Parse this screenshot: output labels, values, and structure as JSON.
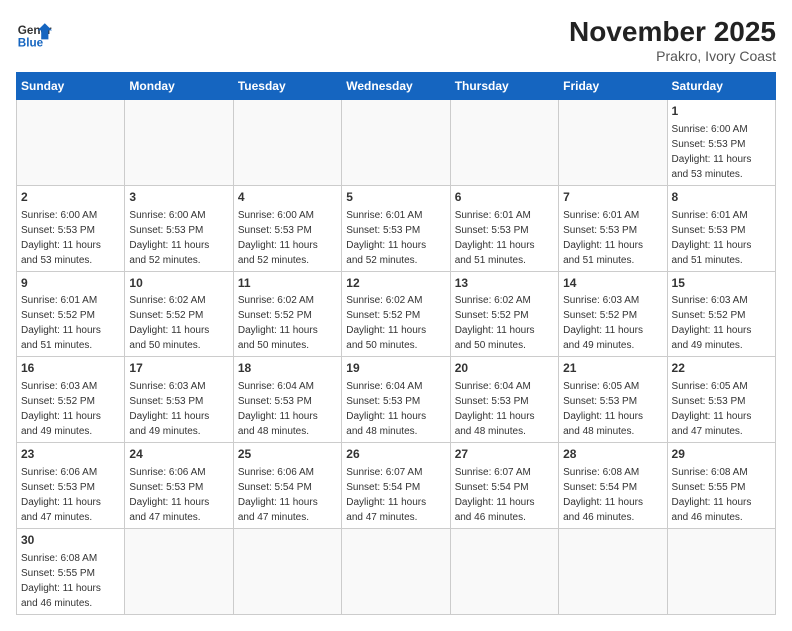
{
  "header": {
    "logo_general": "General",
    "logo_blue": "Blue",
    "month_title": "November 2025",
    "location": "Prakro, Ivory Coast"
  },
  "days_of_week": [
    "Sunday",
    "Monday",
    "Tuesday",
    "Wednesday",
    "Thursday",
    "Friday",
    "Saturday"
  ],
  "weeks": [
    [
      {
        "day": "",
        "info": ""
      },
      {
        "day": "",
        "info": ""
      },
      {
        "day": "",
        "info": ""
      },
      {
        "day": "",
        "info": ""
      },
      {
        "day": "",
        "info": ""
      },
      {
        "day": "",
        "info": ""
      },
      {
        "day": "1",
        "info": "Sunrise: 6:00 AM\nSunset: 5:53 PM\nDaylight: 11 hours\nand 53 minutes."
      }
    ],
    [
      {
        "day": "2",
        "info": "Sunrise: 6:00 AM\nSunset: 5:53 PM\nDaylight: 11 hours\nand 53 minutes."
      },
      {
        "day": "3",
        "info": "Sunrise: 6:00 AM\nSunset: 5:53 PM\nDaylight: 11 hours\nand 52 minutes."
      },
      {
        "day": "4",
        "info": "Sunrise: 6:00 AM\nSunset: 5:53 PM\nDaylight: 11 hours\nand 52 minutes."
      },
      {
        "day": "5",
        "info": "Sunrise: 6:01 AM\nSunset: 5:53 PM\nDaylight: 11 hours\nand 52 minutes."
      },
      {
        "day": "6",
        "info": "Sunrise: 6:01 AM\nSunset: 5:53 PM\nDaylight: 11 hours\nand 51 minutes."
      },
      {
        "day": "7",
        "info": "Sunrise: 6:01 AM\nSunset: 5:53 PM\nDaylight: 11 hours\nand 51 minutes."
      },
      {
        "day": "8",
        "info": "Sunrise: 6:01 AM\nSunset: 5:53 PM\nDaylight: 11 hours\nand 51 minutes."
      }
    ],
    [
      {
        "day": "9",
        "info": "Sunrise: 6:01 AM\nSunset: 5:52 PM\nDaylight: 11 hours\nand 51 minutes."
      },
      {
        "day": "10",
        "info": "Sunrise: 6:02 AM\nSunset: 5:52 PM\nDaylight: 11 hours\nand 50 minutes."
      },
      {
        "day": "11",
        "info": "Sunrise: 6:02 AM\nSunset: 5:52 PM\nDaylight: 11 hours\nand 50 minutes."
      },
      {
        "day": "12",
        "info": "Sunrise: 6:02 AM\nSunset: 5:52 PM\nDaylight: 11 hours\nand 50 minutes."
      },
      {
        "day": "13",
        "info": "Sunrise: 6:02 AM\nSunset: 5:52 PM\nDaylight: 11 hours\nand 50 minutes."
      },
      {
        "day": "14",
        "info": "Sunrise: 6:03 AM\nSunset: 5:52 PM\nDaylight: 11 hours\nand 49 minutes."
      },
      {
        "day": "15",
        "info": "Sunrise: 6:03 AM\nSunset: 5:52 PM\nDaylight: 11 hours\nand 49 minutes."
      }
    ],
    [
      {
        "day": "16",
        "info": "Sunrise: 6:03 AM\nSunset: 5:52 PM\nDaylight: 11 hours\nand 49 minutes."
      },
      {
        "day": "17",
        "info": "Sunrise: 6:03 AM\nSunset: 5:53 PM\nDaylight: 11 hours\nand 49 minutes."
      },
      {
        "day": "18",
        "info": "Sunrise: 6:04 AM\nSunset: 5:53 PM\nDaylight: 11 hours\nand 48 minutes."
      },
      {
        "day": "19",
        "info": "Sunrise: 6:04 AM\nSunset: 5:53 PM\nDaylight: 11 hours\nand 48 minutes."
      },
      {
        "day": "20",
        "info": "Sunrise: 6:04 AM\nSunset: 5:53 PM\nDaylight: 11 hours\nand 48 minutes."
      },
      {
        "day": "21",
        "info": "Sunrise: 6:05 AM\nSunset: 5:53 PM\nDaylight: 11 hours\nand 48 minutes."
      },
      {
        "day": "22",
        "info": "Sunrise: 6:05 AM\nSunset: 5:53 PM\nDaylight: 11 hours\nand 47 minutes."
      }
    ],
    [
      {
        "day": "23",
        "info": "Sunrise: 6:06 AM\nSunset: 5:53 PM\nDaylight: 11 hours\nand 47 minutes."
      },
      {
        "day": "24",
        "info": "Sunrise: 6:06 AM\nSunset: 5:53 PM\nDaylight: 11 hours\nand 47 minutes."
      },
      {
        "day": "25",
        "info": "Sunrise: 6:06 AM\nSunset: 5:54 PM\nDaylight: 11 hours\nand 47 minutes."
      },
      {
        "day": "26",
        "info": "Sunrise: 6:07 AM\nSunset: 5:54 PM\nDaylight: 11 hours\nand 47 minutes."
      },
      {
        "day": "27",
        "info": "Sunrise: 6:07 AM\nSunset: 5:54 PM\nDaylight: 11 hours\nand 46 minutes."
      },
      {
        "day": "28",
        "info": "Sunrise: 6:08 AM\nSunset: 5:54 PM\nDaylight: 11 hours\nand 46 minutes."
      },
      {
        "day": "29",
        "info": "Sunrise: 6:08 AM\nSunset: 5:55 PM\nDaylight: 11 hours\nand 46 minutes."
      }
    ],
    [
      {
        "day": "30",
        "info": "Sunrise: 6:08 AM\nSunset: 5:55 PM\nDaylight: 11 hours\nand 46 minutes."
      },
      {
        "day": "",
        "info": ""
      },
      {
        "day": "",
        "info": ""
      },
      {
        "day": "",
        "info": ""
      },
      {
        "day": "",
        "info": ""
      },
      {
        "day": "",
        "info": ""
      },
      {
        "day": "",
        "info": ""
      }
    ]
  ]
}
